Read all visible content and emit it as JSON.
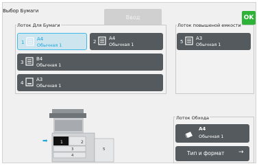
{
  "header": {
    "title": "Выбор Бумаги",
    "apply_label": "Ввод",
    "ok_label": "OK"
  },
  "paper_trays": {
    "label": "Лоток Для Бумаги",
    "trays": [
      {
        "number": "1",
        "size": "A4",
        "type": "Обычная 1",
        "selected": true
      },
      {
        "number": "2",
        "size": "A4",
        "type": "Обычная 1",
        "selected": false
      },
      {
        "number": "3",
        "size": "B4",
        "type": "Обычная 1",
        "selected": false
      },
      {
        "number": "4",
        "size": "A3",
        "type": "Обычная 1",
        "selected": false
      }
    ]
  },
  "high_capacity": {
    "label": "Лоток повышеной емкости",
    "tray": {
      "number": "5",
      "size": "A3",
      "type": "Обычная 1"
    }
  },
  "bypass": {
    "label": "Лоток Обхода",
    "size": "A4",
    "type": "Обычная 1",
    "type_format_label": "Тип и формат"
  },
  "machine": {
    "tray_numbers": [
      "1",
      "2",
      "3",
      "4",
      "5"
    ]
  },
  "colors": {
    "accent": "#1aa6dd",
    "ok_green": "#2eb338",
    "button_dark": "#545a5e"
  }
}
